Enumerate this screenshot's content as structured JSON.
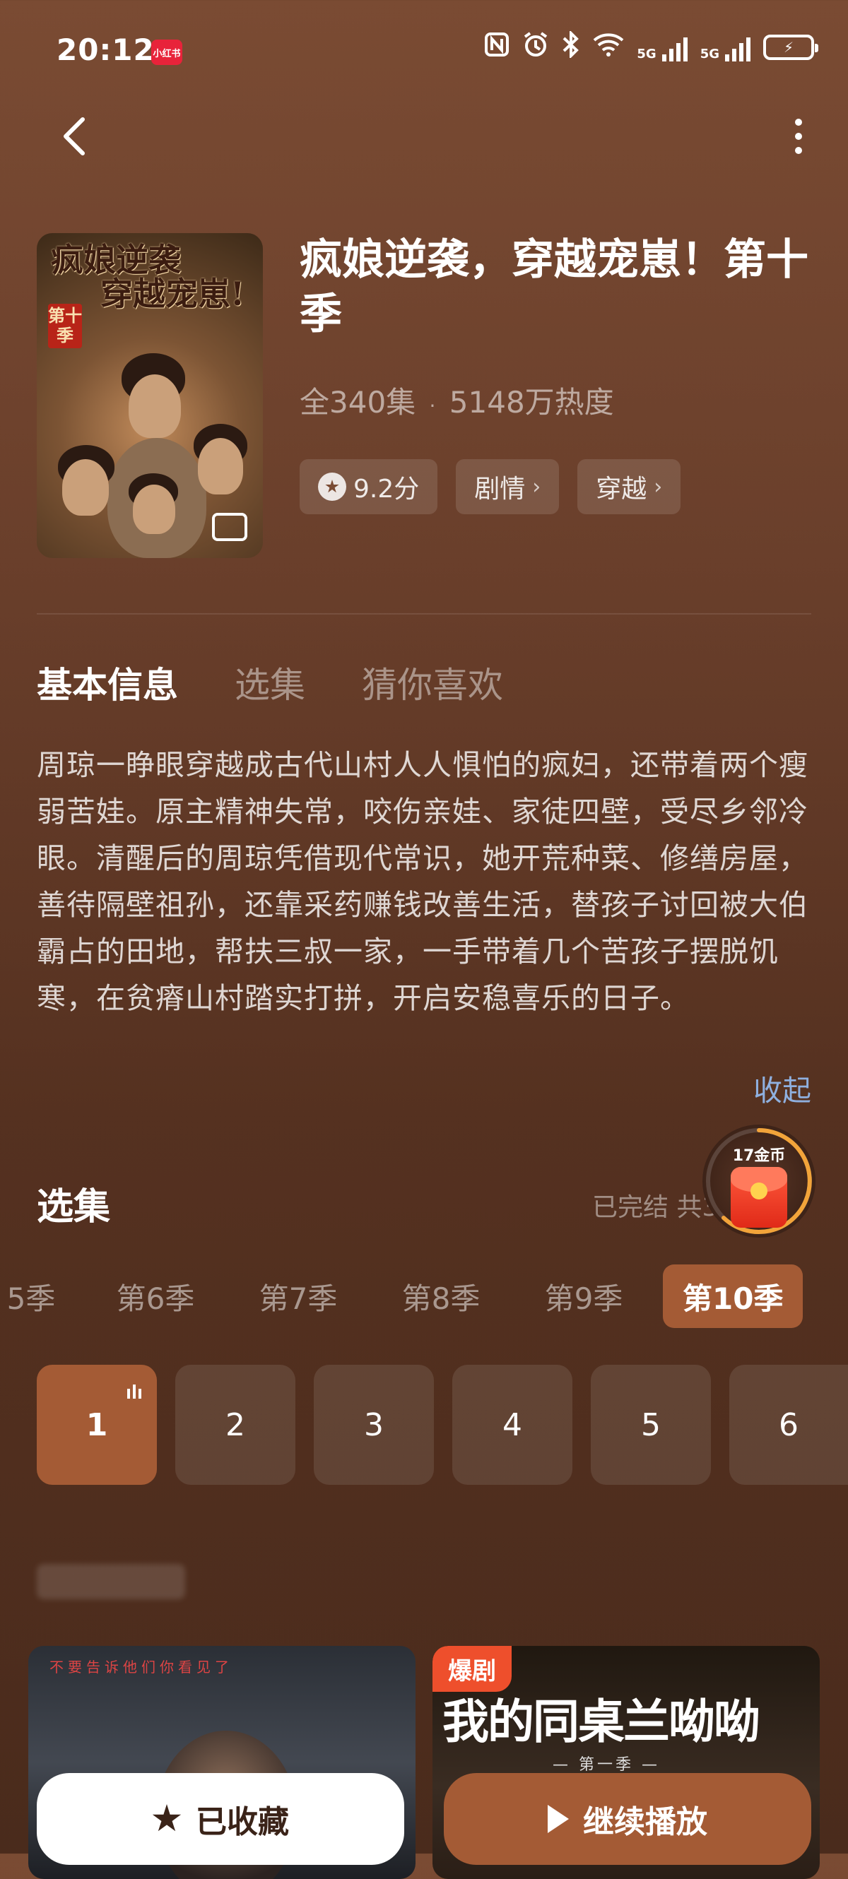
{
  "status_bar": {
    "time": "20:12",
    "app_badge": "小红书",
    "net1": "5G",
    "net2": "5G"
  },
  "cover": {
    "title_line1": "疯娘逆袭",
    "title_line2": "穿越宠崽!",
    "season_tag": "第十季"
  },
  "drama": {
    "title": "疯娘逆袭，穿越宠崽！第十季",
    "episodes_total": "全340集",
    "separator": "·",
    "popularity": "5148万热度",
    "rating": "9.2分",
    "tag1": "剧情",
    "tag2": "穿越"
  },
  "tabs": [
    "基本信息",
    "选集",
    "猜你喜欢"
  ],
  "description": "周琼一睁眼穿越成古代山村人人惧怕的疯妇，还带着两个瘦弱苦娃。原主精神失常，咬伤亲娃、家徒四壁，受尽乡邻冷眼。清醒后的周琼凭借现代常识，她开荒种菜、修缮房屋，善待隔壁祖孙，还靠采药赚钱改善生活，替孩子讨回被大伯霸占的田地，帮扶三叔一家，一手带着几个苦孩子摆脱饥寒，在贫瘠山村踏实打拼，开启安稳喜乐的日子。",
  "collapse_label": "收起",
  "episodes_section": {
    "title": "选集",
    "status": "已完结 共3",
    "coin_label": "17金币"
  },
  "seasons": [
    "5季",
    "第6季",
    "第7季",
    "第8季",
    "第9季",
    "第10季"
  ],
  "episode_numbers": [
    "1",
    "2",
    "3",
    "4",
    "5",
    "6"
  ],
  "recommend": {
    "card1_text": "不要告诉他们你看见了",
    "card2_badge": "爆剧",
    "card2_title": "我的同桌兰呦呦",
    "card2_sub": "第一季"
  },
  "buttons": {
    "favorite": "已收藏",
    "play": "继续播放"
  },
  "colors": {
    "accent": "#a45b35",
    "link": "#8fb0df"
  }
}
